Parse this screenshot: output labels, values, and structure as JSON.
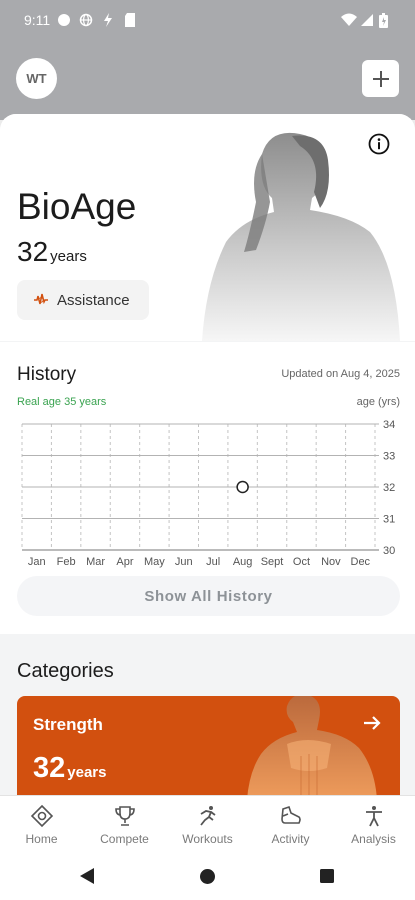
{
  "status_bar": {
    "time": "9:11"
  },
  "header": {
    "avatar_initials": "WT"
  },
  "hero": {
    "title": "BioAge",
    "age_value": "32",
    "age_unit": "years",
    "assistance_label": "Assistance"
  },
  "history": {
    "title": "History",
    "updated": "Updated on Aug 4, 2025",
    "real_age": "Real age 35 years",
    "unit_label": "age (yrs)",
    "show_all_label": "Show All History"
  },
  "chart_data": {
    "type": "scatter",
    "categories": [
      "Jan",
      "Feb",
      "Mar",
      "Apr",
      "May",
      "Jun",
      "Jul",
      "Aug",
      "Sept",
      "Oct",
      "Nov",
      "Dec"
    ],
    "y_ticks": [
      34,
      33,
      32,
      31,
      30
    ],
    "ylim": [
      30,
      34
    ],
    "points": [
      {
        "x": "Aug",
        "y": 32
      }
    ]
  },
  "categories": {
    "title": "Categories",
    "strength": {
      "label": "Strength",
      "value": "32",
      "unit": "years"
    }
  },
  "nav": [
    {
      "label": "Home",
      "icon": "home-icon"
    },
    {
      "label": "Compete",
      "icon": "trophy-icon"
    },
    {
      "label": "Workouts",
      "icon": "run-icon"
    },
    {
      "label": "Activity",
      "icon": "shoe-icon"
    },
    {
      "label": "Analysis",
      "icon": "person-icon"
    }
  ],
  "colors": {
    "accent_orange": "#d2500f",
    "real_age_green": "#3aa350",
    "header_gray": "#a9aaad"
  }
}
